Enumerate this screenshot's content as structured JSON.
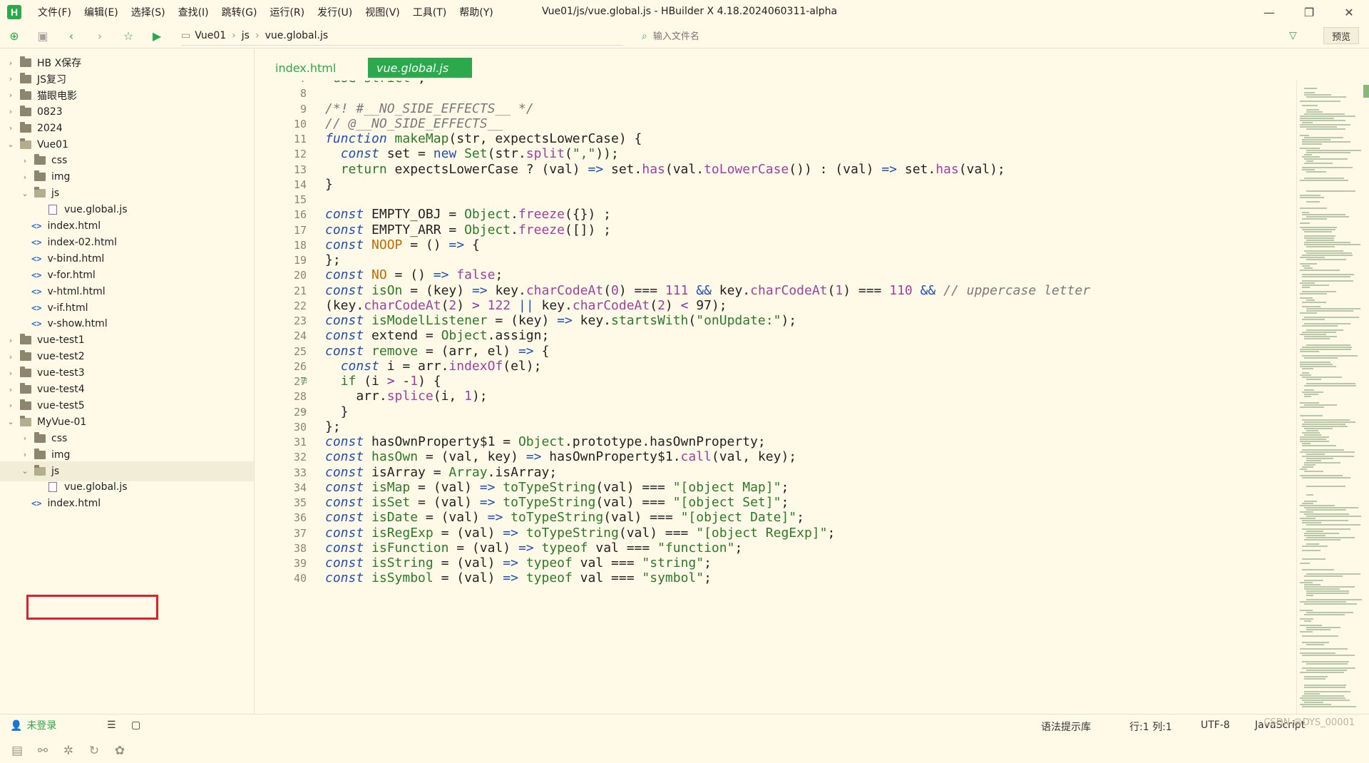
{
  "window": {
    "title": "Vue01/js/vue.global.js - HBuilder X 4.18.2024060311-alpha",
    "logo": "H",
    "minimize": "—",
    "maximize": "❐",
    "close": "✕"
  },
  "menu": [
    "文件(F)",
    "编辑(E)",
    "选择(S)",
    "查找(I)",
    "跳转(G)",
    "运行(R)",
    "发行(U)",
    "视图(V)",
    "工具(T)",
    "帮助(Y)"
  ],
  "breadcrumb": [
    "Vue01",
    "js",
    "vue.global.js"
  ],
  "file_search": {
    "placeholder": "输入文件名"
  },
  "preview_label": "预览",
  "sidebar": {
    "tree": [
      {
        "label": "HB X保存",
        "type": "folder",
        "depth": 0,
        "expanded": false
      },
      {
        "label": "JS复习",
        "type": "folder",
        "depth": 0,
        "expanded": false
      },
      {
        "label": "猫眼电影",
        "type": "folder",
        "depth": 0,
        "expanded": false
      },
      {
        "label": "0823",
        "type": "folder",
        "depth": 0,
        "expanded": false
      },
      {
        "label": "2024",
        "type": "folder",
        "depth": 0,
        "expanded": false
      },
      {
        "label": "Vue01",
        "type": "folder",
        "depth": 0,
        "expanded": true
      },
      {
        "label": "css",
        "type": "folder",
        "depth": 1,
        "expanded": false
      },
      {
        "label": "img",
        "type": "folder",
        "depth": 1,
        "expanded": false
      },
      {
        "label": "js",
        "type": "folder",
        "depth": 1,
        "expanded": true
      },
      {
        "label": "vue.global.js",
        "type": "js",
        "depth": 2
      },
      {
        "label": "index.html",
        "type": "html",
        "depth": 1
      },
      {
        "label": "index-02.html",
        "type": "html",
        "depth": 1
      },
      {
        "label": "v-bind.html",
        "type": "html",
        "depth": 1
      },
      {
        "label": "v-for.html",
        "type": "html",
        "depth": 1
      },
      {
        "label": "v-html.html",
        "type": "html",
        "depth": 1
      },
      {
        "label": "v-if.html",
        "type": "html",
        "depth": 1
      },
      {
        "label": "v-show.html",
        "type": "html",
        "depth": 1
      },
      {
        "label": "vue-test1",
        "type": "folder",
        "depth": 0,
        "expanded": false
      },
      {
        "label": "vue-test2",
        "type": "folder",
        "depth": 0,
        "expanded": false
      },
      {
        "label": "vue-test3",
        "type": "folder",
        "depth": 0,
        "expanded": false
      },
      {
        "label": "vue-test4",
        "type": "folder",
        "depth": 0,
        "expanded": false
      },
      {
        "label": "vue-test5",
        "type": "folder",
        "depth": 0,
        "expanded": false
      },
      {
        "label": "MyVue-01",
        "type": "folder",
        "depth": 0,
        "expanded": true
      },
      {
        "label": "css",
        "type": "folder",
        "depth": 1,
        "expanded": false
      },
      {
        "label": "img",
        "type": "folder",
        "depth": 1,
        "expanded": false
      },
      {
        "label": "js",
        "type": "folder",
        "depth": 1,
        "expanded": true,
        "selected": true
      },
      {
        "label": "vue.global.js",
        "type": "js",
        "depth": 2,
        "highlighted": true
      },
      {
        "label": "index.html",
        "type": "html",
        "depth": 1
      }
    ]
  },
  "tabs": [
    {
      "label": "index.html",
      "active": false
    },
    {
      "label": "vue.global.js",
      "active": true
    }
  ],
  "code": {
    "first_line": 7,
    "lines": [
      [
        [
          "str",
          "'use strict'"
        ],
        [
          "",
          ";"
        ]
      ],
      [],
      [
        [
          "cm",
          "/*! #__NO_SIDE_EFFECTS__ */"
        ]
      ],
      [
        [
          "cm",
          "// @__NO_SIDE_EFFECTS__"
        ]
      ],
      [
        [
          "kw",
          "function"
        ],
        [
          "",
          " "
        ],
        [
          "obj",
          "makeMap"
        ],
        [
          "",
          "(str, expectsLowerCase) {"
        ]
      ],
      [
        [
          "",
          "  "
        ],
        [
          "kw",
          "const"
        ],
        [
          "",
          " set = "
        ],
        [
          "kw2",
          "new"
        ],
        [
          "",
          " "
        ],
        [
          "obj",
          "Set"
        ],
        [
          "",
          "(str."
        ],
        [
          "fn",
          "split"
        ],
        [
          "",
          "("
        ],
        [
          "str",
          "\",\""
        ],
        [
          "",
          "));"
        ]
      ],
      [
        [
          "",
          "  "
        ],
        [
          "obj",
          "return"
        ],
        [
          "",
          " expectsLowerCase ? (val) "
        ],
        [
          "kw2",
          "=>"
        ],
        [
          "",
          " set."
        ],
        [
          "fn",
          "has"
        ],
        [
          "",
          "(val."
        ],
        [
          "fn",
          "toLowerCase"
        ],
        [
          "",
          "()) : (val) "
        ],
        [
          "kw2",
          "=>"
        ],
        [
          "",
          " set."
        ],
        [
          "fn",
          "has"
        ],
        [
          "",
          "(val);"
        ]
      ],
      [
        [
          "",
          "}"
        ]
      ],
      [],
      [
        [
          "kw",
          "const"
        ],
        [
          "",
          " EMPTY_OBJ = "
        ],
        [
          "obj",
          "Object"
        ],
        [
          "",
          "."
        ],
        [
          "fn",
          "freeze"
        ],
        [
          "",
          "({}) ;"
        ]
      ],
      [
        [
          "kw",
          "const"
        ],
        [
          "",
          " EMPTY_ARR = "
        ],
        [
          "obj",
          "Object"
        ],
        [
          "",
          "."
        ],
        [
          "fn",
          "freeze"
        ],
        [
          "",
          "([]) ;"
        ]
      ],
      [
        [
          "kw",
          "const"
        ],
        [
          "",
          " "
        ],
        [
          "cst",
          "NOOP"
        ],
        [
          "",
          " = () "
        ],
        [
          "kw2",
          "=>"
        ],
        [
          "",
          " {"
        ]
      ],
      [
        [
          "",
          "};"
        ]
      ],
      [
        [
          "kw",
          "const"
        ],
        [
          "",
          " "
        ],
        [
          "cst",
          "NO"
        ],
        [
          "",
          " = () "
        ],
        [
          "kw2",
          "=>"
        ],
        [
          "",
          " "
        ],
        [
          "fn",
          "false"
        ],
        [
          "",
          ";"
        ]
      ],
      [
        [
          "kw",
          "const"
        ],
        [
          "",
          " "
        ],
        [
          "obj",
          "isOn"
        ],
        [
          "",
          " = (key) "
        ],
        [
          "kw2",
          "=>"
        ],
        [
          "",
          " key."
        ],
        [
          "fn",
          "charCodeAt"
        ],
        [
          "",
          "("
        ],
        [
          "num",
          "0"
        ],
        [
          "",
          ") === "
        ],
        [
          "num",
          "111"
        ],
        [
          "",
          " "
        ],
        [
          "kw2",
          "&&"
        ],
        [
          "",
          " key."
        ],
        [
          "fn",
          "charCodeAt"
        ],
        [
          "",
          "("
        ],
        [
          "num",
          "1"
        ],
        [
          "",
          ") === "
        ],
        [
          "num",
          "110"
        ],
        [
          "",
          " "
        ],
        [
          "kw2",
          "&&"
        ],
        [
          "",
          " "
        ],
        [
          "cm",
          "// uppercase letter"
        ]
      ],
      [
        [
          "",
          "(key."
        ],
        [
          "fn",
          "charCodeAt"
        ],
        [
          "",
          "("
        ],
        [
          "num",
          "2"
        ],
        [
          "",
          ") "
        ],
        [
          "pr",
          ">"
        ],
        [
          "",
          " "
        ],
        [
          "num",
          "122"
        ],
        [
          "",
          " "
        ],
        [
          "kw2",
          "||"
        ],
        [
          "",
          " key."
        ],
        [
          "fn",
          "charCodeAt"
        ],
        [
          "",
          "("
        ],
        [
          "num",
          "2"
        ],
        [
          "",
          ") "
        ],
        [
          "pr",
          "<"
        ],
        [
          "",
          " 97);"
        ]
      ],
      [
        [
          "kw",
          "const"
        ],
        [
          "",
          " "
        ],
        [
          "obj",
          "isModelListener"
        ],
        [
          "",
          " = (key) "
        ],
        [
          "kw2",
          "=>"
        ],
        [
          "",
          " key."
        ],
        [
          "obj",
          "startsWith"
        ],
        [
          "",
          "("
        ],
        [
          "str",
          "\"onUpdate:\""
        ],
        [
          "",
          ");"
        ]
      ],
      [
        [
          "kw",
          "const"
        ],
        [
          "",
          " extend = "
        ],
        [
          "obj",
          "Object"
        ],
        [
          "",
          ".assign;"
        ]
      ],
      [
        [
          "kw",
          "const"
        ],
        [
          "",
          " "
        ],
        [
          "obj",
          "remove"
        ],
        [
          "",
          " = (arr, el) "
        ],
        [
          "kw2",
          "=>"
        ],
        [
          "",
          " {"
        ]
      ],
      [
        [
          "",
          "  "
        ],
        [
          "kw",
          "const"
        ],
        [
          "",
          " i = arr."
        ],
        [
          "fn",
          "indexOf"
        ],
        [
          "",
          "(el);"
        ]
      ],
      [
        [
          "",
          "  "
        ],
        [
          "obj",
          "if"
        ],
        [
          "",
          " (i "
        ],
        [
          "pr",
          ">"
        ],
        [
          "",
          " -"
        ],
        [
          "num",
          "1"
        ],
        [
          "",
          ") {"
        ]
      ],
      [
        [
          "",
          "    arr."
        ],
        [
          "fn",
          "splice"
        ],
        [
          "",
          "(i, "
        ],
        [
          "num",
          "1"
        ],
        [
          "",
          ");"
        ]
      ],
      [
        [
          "",
          "  }"
        ]
      ],
      [
        [
          "",
          "};"
        ]
      ],
      [
        [
          "kw",
          "const"
        ],
        [
          "",
          " hasOwnProperty$1 = "
        ],
        [
          "obj",
          "Object"
        ],
        [
          "",
          ".prototype.hasOwnProperty;"
        ]
      ],
      [
        [
          "kw",
          "const"
        ],
        [
          "",
          " "
        ],
        [
          "obj",
          "hasOwn"
        ],
        [
          "",
          " = (val, key) "
        ],
        [
          "kw2",
          "=>"
        ],
        [
          "",
          " hasOwnProperty$1."
        ],
        [
          "fn",
          "call"
        ],
        [
          "",
          "(val, key);"
        ]
      ],
      [
        [
          "kw",
          "const"
        ],
        [
          "",
          " isArray = "
        ],
        [
          "obj",
          "Array"
        ],
        [
          "",
          ".isArray;"
        ]
      ],
      [
        [
          "kw",
          "const"
        ],
        [
          "",
          " "
        ],
        [
          "obj",
          "isMap"
        ],
        [
          "",
          " = (val) "
        ],
        [
          "kw2",
          "=>"
        ],
        [
          "",
          " "
        ],
        [
          "obj",
          "toTypeString"
        ],
        [
          "",
          "(val) === "
        ],
        [
          "str",
          "\"[object Map]\""
        ],
        [
          "",
          ";"
        ]
      ],
      [
        [
          "kw",
          "const"
        ],
        [
          "",
          " "
        ],
        [
          "obj",
          "isSet"
        ],
        [
          "",
          " = (val) "
        ],
        [
          "kw2",
          "=>"
        ],
        [
          "",
          " "
        ],
        [
          "obj",
          "toTypeString"
        ],
        [
          "",
          "(val) === "
        ],
        [
          "str",
          "\"[object Set]\""
        ],
        [
          "",
          ";"
        ]
      ],
      [
        [
          "kw",
          "const"
        ],
        [
          "",
          " "
        ],
        [
          "obj",
          "isDate"
        ],
        [
          "",
          " = (val) "
        ],
        [
          "kw2",
          "=>"
        ],
        [
          "",
          " "
        ],
        [
          "obj",
          "toTypeString"
        ],
        [
          "",
          "(val) === "
        ],
        [
          "str",
          "\"[object Date]\""
        ],
        [
          "",
          ";"
        ]
      ],
      [
        [
          "kw",
          "const"
        ],
        [
          "",
          " "
        ],
        [
          "obj",
          "isRegExp"
        ],
        [
          "",
          " = (val) "
        ],
        [
          "kw2",
          "=>"
        ],
        [
          "",
          " "
        ],
        [
          "obj",
          "toTypeString"
        ],
        [
          "",
          "(val) === "
        ],
        [
          "str",
          "\"[object RegExp]\""
        ],
        [
          "",
          ";"
        ]
      ],
      [
        [
          "kw",
          "const"
        ],
        [
          "",
          " "
        ],
        [
          "obj",
          "isFunction"
        ],
        [
          "",
          " = (val) "
        ],
        [
          "kw2",
          "=>"
        ],
        [
          "",
          " "
        ],
        [
          "obj",
          "typeof"
        ],
        [
          "",
          " val === "
        ],
        [
          "str",
          "\"function\""
        ],
        [
          "",
          ";"
        ]
      ],
      [
        [
          "kw",
          "const"
        ],
        [
          "",
          " "
        ],
        [
          "obj",
          "isString"
        ],
        [
          "",
          " = (val) "
        ],
        [
          "kw2",
          "=>"
        ],
        [
          "",
          " "
        ],
        [
          "obj",
          "typeof"
        ],
        [
          "",
          " val === "
        ],
        [
          "str",
          "\"string\""
        ],
        [
          "",
          ";"
        ]
      ],
      [
        [
          "kw",
          "const"
        ],
        [
          "",
          " "
        ],
        [
          "obj",
          "isSymbol"
        ],
        [
          "",
          " = (val) "
        ],
        [
          "kw2",
          "=>"
        ],
        [
          "",
          " "
        ],
        [
          "obj",
          "typeof"
        ],
        [
          "",
          " val === "
        ],
        [
          "str",
          "\"symbol\""
        ],
        [
          "",
          ";"
        ]
      ]
    ],
    "fold_markers": {
      "27": "⊟",
      "29": "⌐"
    }
  },
  "statusbar": {
    "login": "未登录",
    "syntax_lib": "语法提示库",
    "position": "行:1  列:1",
    "encoding": "UTF-8",
    "language": "JavaScript",
    "watermark": "CSDN @DYS_00001"
  },
  "colors": {
    "accent": "#2aaa4a",
    "background": "#fffae8",
    "highlight_box": "#e0202a"
  }
}
